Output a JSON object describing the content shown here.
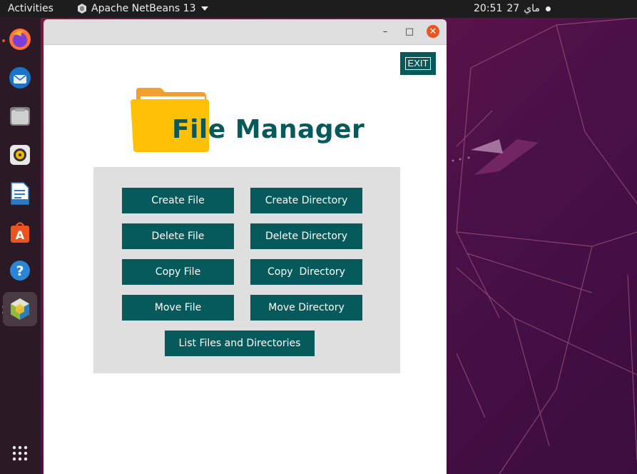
{
  "topbar": {
    "activities": "Activities",
    "app_name": "Apache NetBeans 13",
    "time": "20:51",
    "date_day": "27",
    "date_month": "ماي"
  },
  "dock": {
    "items": [
      {
        "icon": "firefox-icon"
      },
      {
        "icon": "thunderbird-icon"
      },
      {
        "icon": "files-icon"
      },
      {
        "icon": "rhythmbox-icon"
      },
      {
        "icon": "libreoffice-writer-icon"
      },
      {
        "icon": "app-center-icon"
      },
      {
        "icon": "help-icon"
      },
      {
        "icon": "netbeans-icon"
      },
      {
        "icon": "show-apps-icon"
      }
    ]
  },
  "window": {
    "minimize": "–",
    "maximize": "□",
    "close": "✕",
    "exit_label": "EXIT",
    "title": "File Manager",
    "buttons": {
      "create_file": "Create File",
      "create_directory": "Create Directory",
      "delete_file": "Delete File",
      "delete_directory": "Delete Directory",
      "copy_file": "Copy File",
      "copy_directory": "Copy  Directory",
      "move_file": "Move File",
      "move_directory": "Move Directory",
      "list_files": "List Files and Directories"
    }
  },
  "colors": {
    "accent": "#065a5c",
    "panel": "#dfdfdf",
    "close": "#e95420",
    "folder": "#ffc107"
  }
}
